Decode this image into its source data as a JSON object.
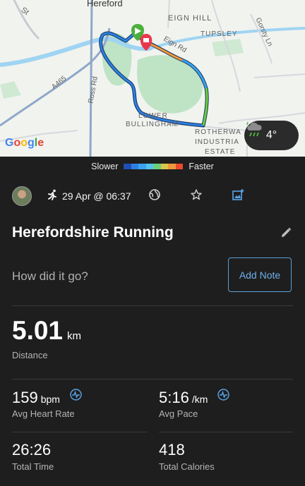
{
  "map": {
    "labels": {
      "hereford": "Hereford",
      "st": "St",
      "eign_hill": "EIGN HILL",
      "tupsley": "TUPSLEY",
      "gorsty_ln": "Gorsty Ln",
      "eign_rd": "Eign Rd",
      "a465": "A465",
      "ross_rd": "Ross Rd",
      "lower": "LOWER",
      "bullingham": "BULLINGHAM",
      "rotherwas": "ROTHERWA",
      "industrial": "INDUSTRIA",
      "estate": "ESTATE"
    },
    "google_logo": [
      "G",
      "o",
      "o",
      "g",
      "l",
      "e"
    ],
    "google_colors": [
      "#4285F4",
      "#EA4335",
      "#FBBC05",
      "#4285F4",
      "#34A853",
      "#EA4335"
    ],
    "weather": {
      "temp": "4°",
      "icon": "cloud-rain-icon"
    }
  },
  "legend": {
    "slower": "Slower",
    "faster": "Faster",
    "colors": [
      "#1f4fb5",
      "#2d7fe0",
      "#3aa3f0",
      "#52c2ef",
      "#6ccf7c",
      "#d9c74a",
      "#f0973b",
      "#ea4b2a"
    ]
  },
  "activity": {
    "date": "29 Apr @ 06:37",
    "title": "Herefordshire Running",
    "prompt": "How did it go?",
    "add_note": "Add Note"
  },
  "stats": {
    "distance": {
      "value": "5.01",
      "unit": "km",
      "label": "Distance"
    },
    "heart_rate": {
      "value": "159",
      "unit": "bpm",
      "label": "Avg Heart Rate"
    },
    "pace": {
      "value": "5:16",
      "unit": "/km",
      "label": "Avg Pace"
    },
    "time": {
      "value": "26:26",
      "label": "Total Time"
    },
    "calories": {
      "value": "418",
      "label": "Total Calories"
    }
  }
}
